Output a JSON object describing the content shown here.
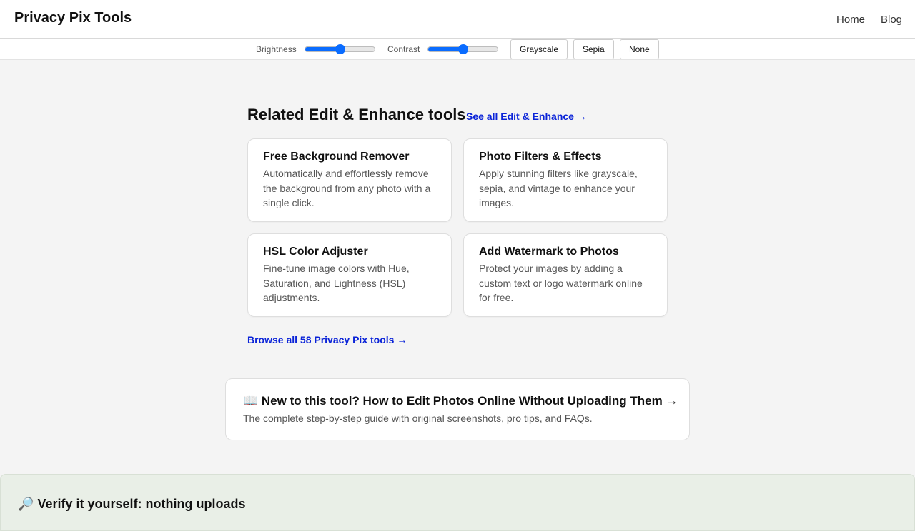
{
  "header": {
    "brand": "Privacy Pix Tools",
    "nav": [
      {
        "label": "Home"
      },
      {
        "label": "Blog"
      }
    ]
  },
  "toolbar": {
    "brightness": {
      "label": "Brightness",
      "value_fraction": 0.5
    },
    "contrast": {
      "label": "Contrast",
      "value_fraction": 0.5
    },
    "buttons": [
      {
        "label": "Grayscale"
      },
      {
        "label": "Sepia"
      },
      {
        "label": "None"
      }
    ],
    "accent_color": "#0a6cff"
  },
  "related": {
    "title": "Related Edit & Enhance tools",
    "see_all": "See all Edit & Enhance →",
    "cards": [
      {
        "title": "Free Background Remover",
        "desc": "Automatically and effortlessly remove the background from any photo with a single click."
      },
      {
        "title": "Photo Filters & Effects",
        "desc": "Apply stunning filters like grayscale, sepia, and vintage to enhance your images."
      },
      {
        "title": "HSL Color Adjuster",
        "desc": "Fine-tune image colors with Hue, Saturation, and Lightness (HSL) adjustments."
      },
      {
        "title": "Add Watermark to Photos",
        "desc": "Protect your images by adding a custom text or logo watermark online for free."
      }
    ],
    "browse_all": "Browse all 58 Privacy Pix tools →",
    "link_color": "#0a23d8"
  },
  "guide": {
    "icon": "📖",
    "title": "New to this tool? How to Edit Photos Online Without Uploading Them →",
    "desc": "The complete step-by-step guide with original screenshots, pro tips, and FAQs."
  },
  "verify": {
    "icon": "🔎",
    "heading": "Verify it yourself: nothing uploads"
  }
}
